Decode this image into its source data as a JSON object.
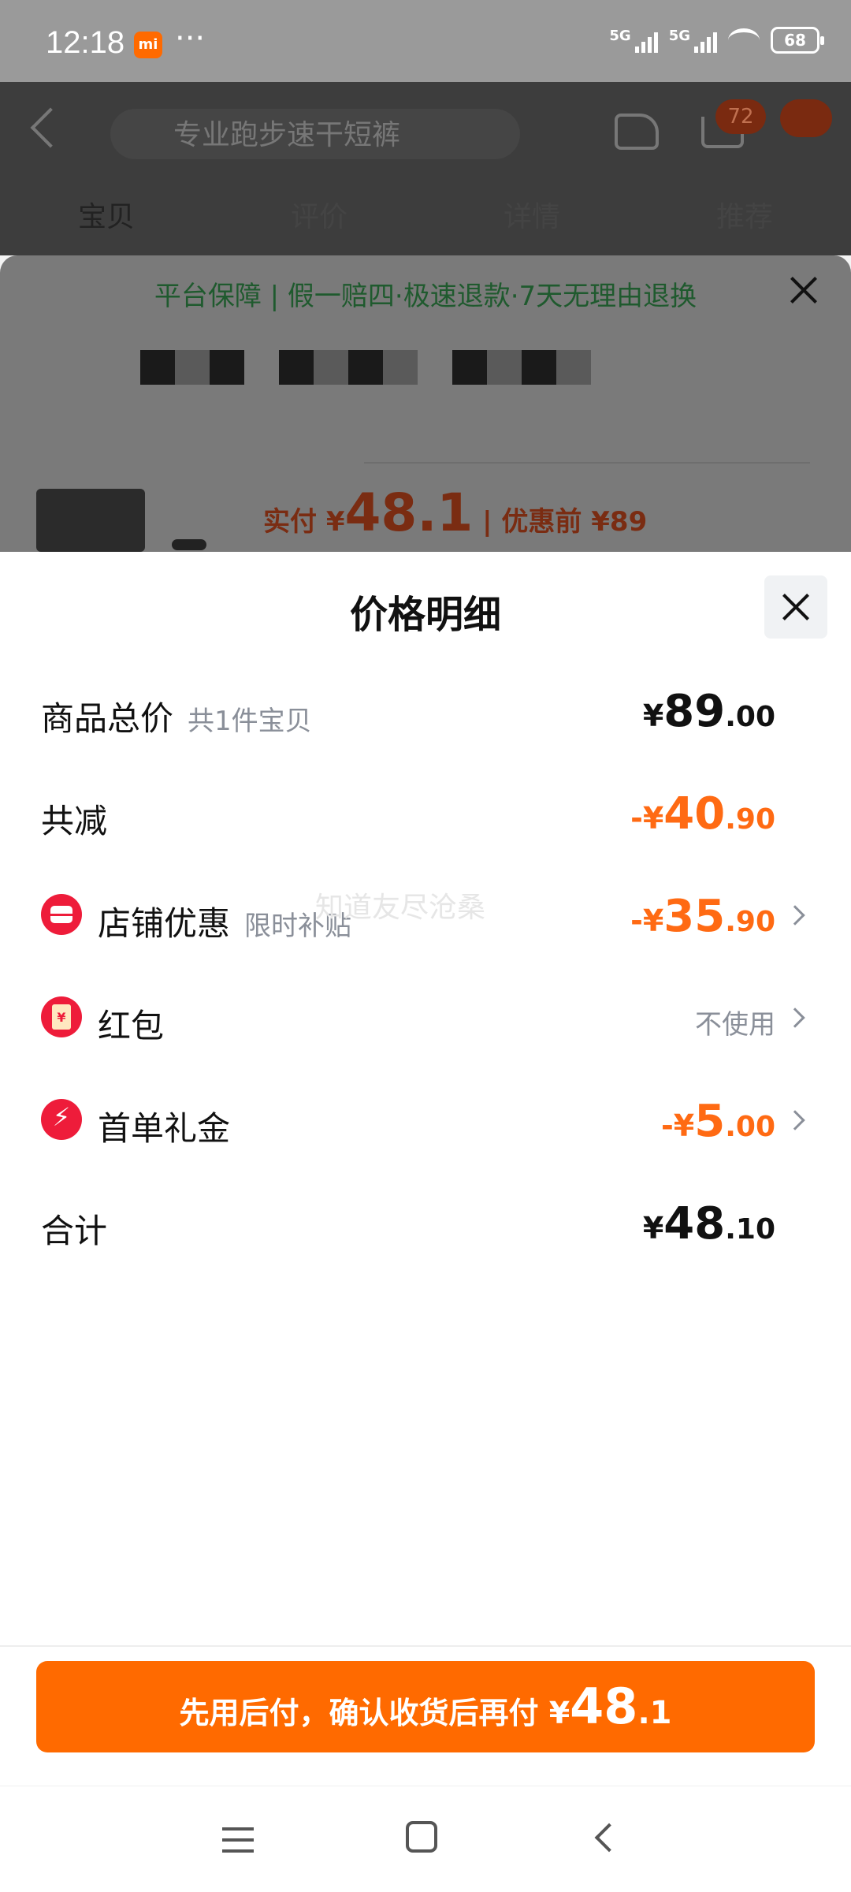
{
  "status_bar": {
    "time": "12:18",
    "mi_badge": "mi",
    "more_dots": "···",
    "net1": "5G",
    "net2": "5G",
    "battery": "68"
  },
  "product_page": {
    "search_text": "专业跑步速干短裤",
    "cart_badge": "72",
    "tabs": [
      "宝贝",
      "评价",
      "详情",
      "推荐"
    ],
    "guarantee": "平台保障 | 假一赔四·极速退款·7天无理由退换",
    "price_prefix": "实付 ¥",
    "price_value": "48.1",
    "price_suffix": " | 优惠前 ¥89"
  },
  "sheet": {
    "title": "价格明细",
    "rows": [
      {
        "label": "商品总价",
        "sub": "共1件宝贝",
        "cur": "¥",
        "int": "89",
        "dec": ".00"
      },
      {
        "label": "共减",
        "cur": "-¥",
        "int": "40",
        "dec": ".90"
      },
      {
        "label": "店铺优惠",
        "sub": "限时补贴",
        "cur": "-¥",
        "int": "35",
        "dec": ".90"
      },
      {
        "label": "红包",
        "value_text": "不使用"
      },
      {
        "label": "首单礼金",
        "cur": "-¥",
        "int": "5",
        "dec": ".00"
      },
      {
        "label": "合计",
        "cur": "¥",
        "int": "48",
        "dec": ".10"
      }
    ],
    "watermark": "知道友尽沧桑"
  },
  "pay_button": {
    "text": "先用后付，确认收货后再付 ¥",
    "int": "48",
    "dec": ".1"
  },
  "colors": {
    "accent_orange": "#ff6a00",
    "discount_orange": "#ff6a13",
    "icon_red": "#ee1c3a"
  }
}
